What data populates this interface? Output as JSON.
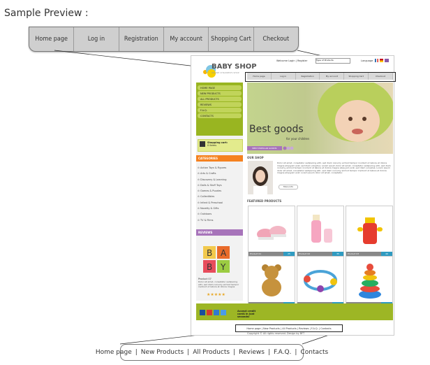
{
  "sample_title": "Sample Preview :",
  "big_menu": [
    "Home page",
    "Log in",
    "Registration",
    "My account",
    "Shopping Cart",
    "Checkout"
  ],
  "big_footer": [
    "Home page",
    "New Products",
    "All Products",
    "Reviews",
    "F.A.Q.",
    "Contacts"
  ],
  "site": {
    "logo": "BABY SHOP",
    "logo_sub": "ONLINE CHILDREN'S SHOP",
    "top_links": "Welcome Login | Register",
    "select_value": "Type of Products",
    "language_label": "Language",
    "nav": [
      "Home page",
      "Log in",
      "Registration",
      "My account",
      "Shopping Cart",
      "Checkout"
    ],
    "left_nav": [
      "HOME PAGE",
      "NEW PRODUCTS",
      "ALL PRODUCTS",
      "REVIEWS",
      "F.A.Q.",
      "CONTACTS"
    ],
    "cart_title": "Shopping cart:",
    "cart_items": "0 items",
    "categories_title": "CATEGORIES",
    "categories": [
      "Action Toys & Figures",
      "Arts & Crafts",
      "Discovery & Learning",
      "Dolls & Stuff Toys",
      "Games & Puzzles",
      "Collectibles",
      "Infant & Preschool",
      "Novelty & Gifts",
      "Outdoors",
      "TV & Films"
    ],
    "reviews_title": "REVIEWS",
    "review_product": "Product 07",
    "review_text": "Dolor sit amet, consetetur sadipscing elitr, sed diam nonumy eirmod tempor invidunt ut labore et dolore magna",
    "review_stars": "★★★★★",
    "hero_title": "Best goods",
    "hero_sub": "for your children",
    "hero_band": "BEST POPULAR GOODS",
    "our_shop": "OUR SHOP",
    "shop_text": "Dolor sit amet, consetetur sadipscing elitr, sed diam nonumy eirmod tempor invidunt ut labore et dolore magna aliquyam erat, sed diam voluptua. Lorem ipsum dolor sit amet, consetetur sadipscing elitr, sed diam nonumy eirmod tempor invidunt ut labore et dolore magna aliquyam erat, sed diam voluptua. Lorem ipsum dolor sit amet, consetetur sadipscing elitr, sed diam nonumy eirmod tempor invidunt ut labore et dolore magna aliquyam erat. Lorem ipsum dolor sit amet, consetetur.",
    "more_info": "More info",
    "featured": "FEATURED PRODUCTS",
    "products": [
      {
        "name": "Product 01",
        "price": "25"
      },
      {
        "name": "Product 02",
        "price": "35"
      },
      {
        "name": "Product 03",
        "price": "49"
      },
      {
        "name": "Product 04",
        "price": "20"
      },
      {
        "name": "Product 05",
        "price": "27"
      },
      {
        "name": "Product 06",
        "price": "45"
      }
    ],
    "cards_text": "Accept credit cards in just seconds!",
    "footer_links": "Home page | New Products | All Products | Reviews | F.A.Q. | Contacts",
    "copyright": "Copyright © All rights reserved. Design by BFT"
  }
}
